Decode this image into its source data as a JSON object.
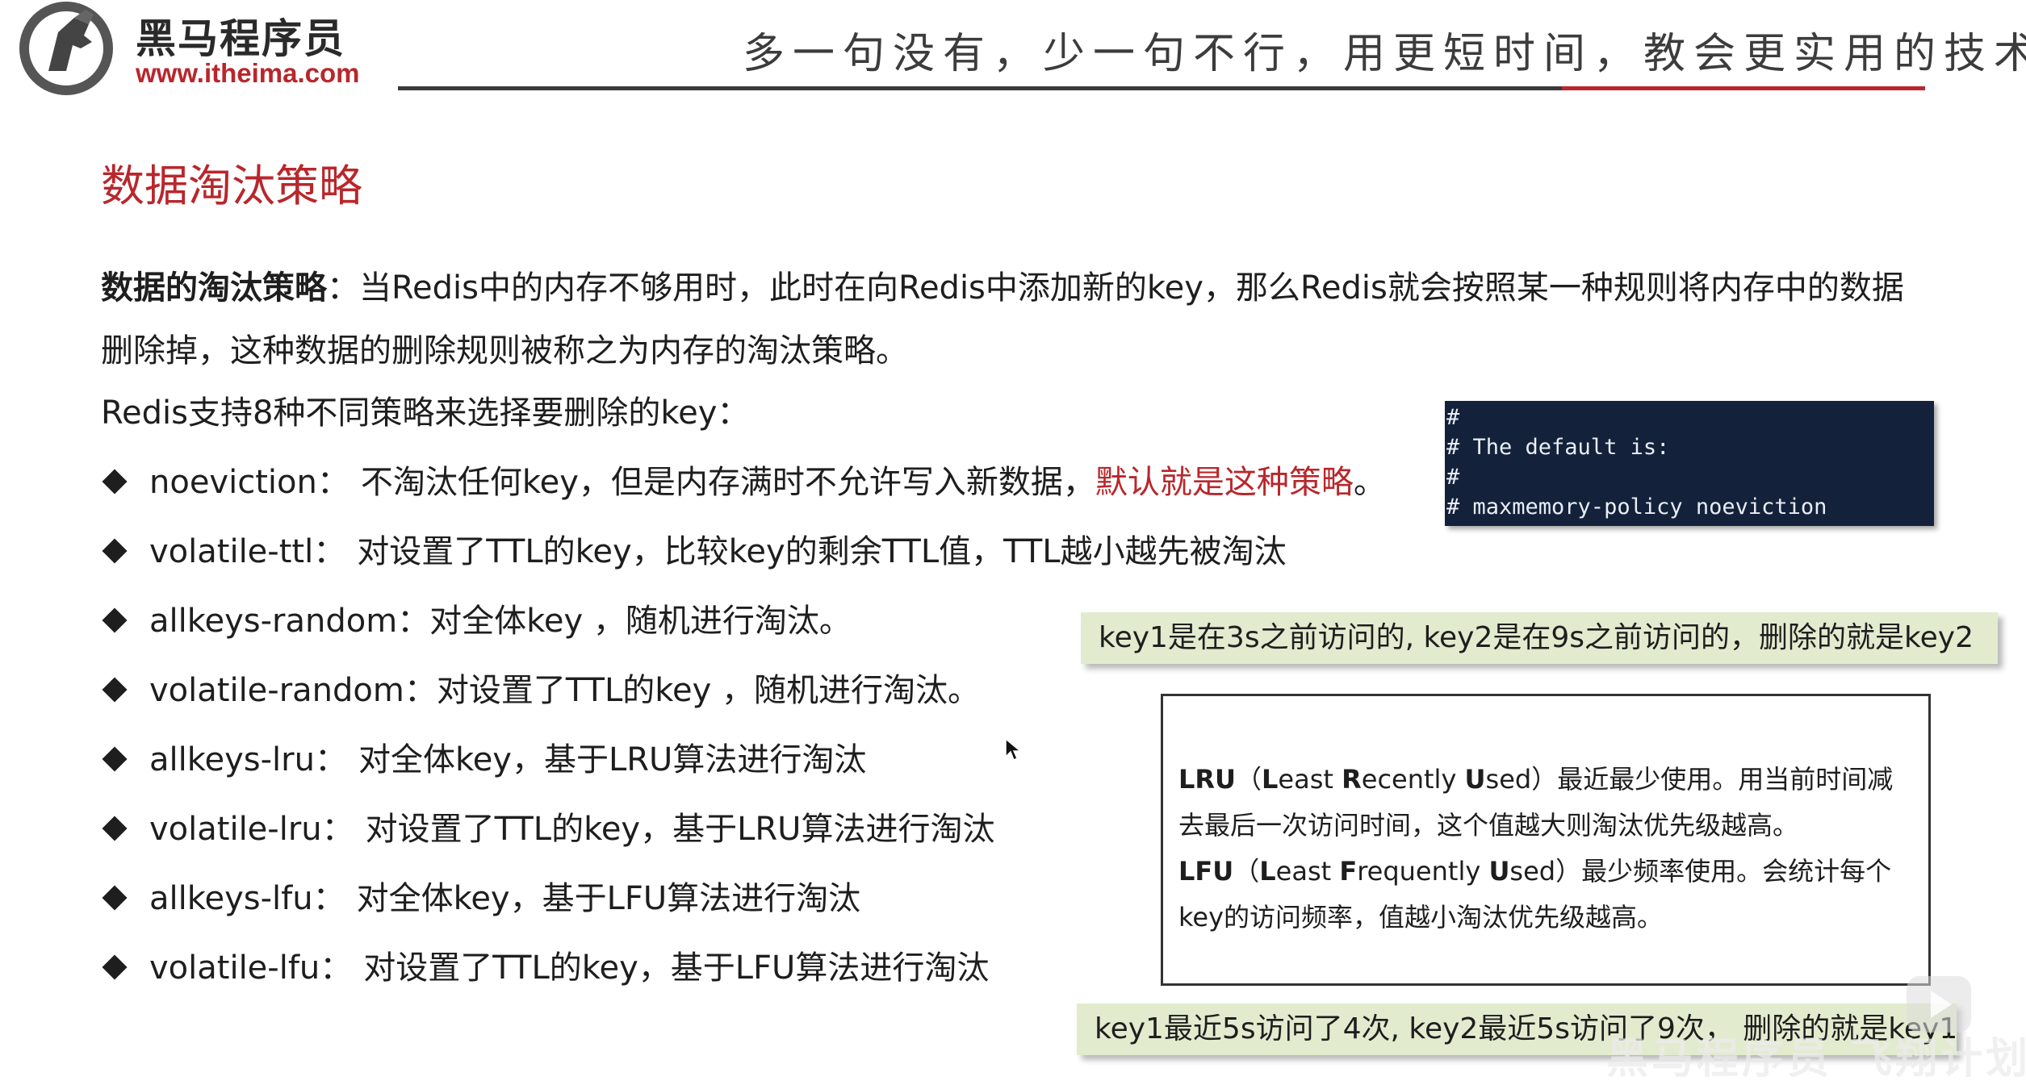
{
  "header": {
    "brand_name": "黑马程序员",
    "brand_url": "www.itheima.com",
    "slogan": "多一句没有，少一句不行，用更短时间，教会更实用的技术！",
    "accent_color": "#b8272c"
  },
  "title": "数据淘汰策略",
  "intro": {
    "term": "数据的淘汰策略",
    "text": "：当Redis中的内存不够用时，此时在向Redis中添加新的key，那么Redis就会按照某一种规则将内存中的数据删除掉，这种数据的删除规则被称之为内存的淘汰策略。"
  },
  "support_text": "Redis支持8种不同策略来选择要删除的key：",
  "policies": [
    {
      "name": "noeviction：",
      "desc": "不淘汰任何key，但是内存满时不允许写入新数据，",
      "highlight": "默认就是这种策略",
      "tail": "。"
    },
    {
      "name": "volatile-ttl：",
      "desc": "对设置了TTL的key，比较key的剩余TTL值，TTL越小越先被淘汰"
    },
    {
      "name": "allkeys-random：",
      "desc": "对全体key ，随机进行淘汰。"
    },
    {
      "name": "volatile-random：",
      "desc": "对设置了TTL的key ，随机进行淘汰。"
    },
    {
      "name": "allkeys-lru：",
      "desc": "对全体key，基于LRU算法进行淘汰"
    },
    {
      "name": "volatile-lru：",
      "desc": "对设置了TTL的key，基于LRU算法进行淘汰"
    },
    {
      "name": "allkeys-lfu：",
      "desc": "对全体key，基于LFU算法进行淘汰"
    },
    {
      "name": "volatile-lfu：",
      "desc": "对设置了TTL的key，基于LFU算法进行淘汰"
    }
  ],
  "code": {
    "lines": [
      "#",
      "# The default is:",
      "#",
      "# maxmemory-policy noeviction"
    ]
  },
  "notes": {
    "lru_example": "key1是在3s之前访问的, key2是在9s之前访问的，删除的就是key2",
    "lfu_example": "key1最近5s访问了4次, key2最近5s访问了9次， 删除的就是key1"
  },
  "algo": {
    "lru_abbr": "LRU",
    "lru_open": "（",
    "lru_L": "L",
    "lru_east": "east ",
    "lru_R": "R",
    "lru_ecently": "ecently ",
    "lru_U": "U",
    "lru_sed": "sed",
    "lru_close": "）",
    "lru_desc": "最近最少使用。用当前时间减去最后一次访问时间，这个值越大则淘汰优先级越高。",
    "lfu_abbr": "LFU",
    "lfu_open": "（",
    "lfu_L": "L",
    "lfu_east": "east ",
    "lfu_F": "F",
    "lfu_requently": "requently ",
    "lfu_U": "U",
    "lfu_sed": "sed",
    "lfu_close": "）",
    "lfu_desc": "最少频率使用。会统计每个key的访问频率，值越小淘汰优先级越高。"
  },
  "watermark": "黑马程序员 飞翔计划"
}
